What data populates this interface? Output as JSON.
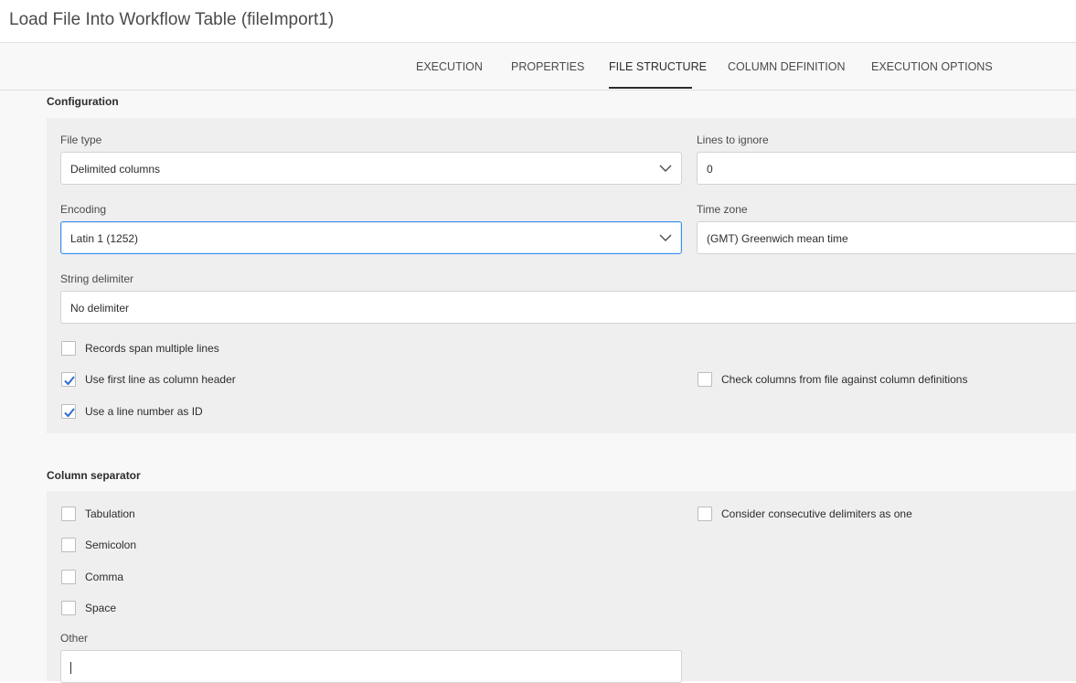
{
  "window": {
    "title": "Load File Into Workflow Table (fileImport1)"
  },
  "tabs": [
    {
      "label": "EXECUTION",
      "active": false
    },
    {
      "label": "PROPERTIES",
      "active": false
    },
    {
      "label": "FILE STRUCTURE",
      "active": true
    },
    {
      "label": "COLUMN DEFINITION",
      "active": false
    },
    {
      "label": "EXECUTION OPTIONS",
      "active": false
    }
  ],
  "configuration": {
    "title": "Configuration",
    "file_type": {
      "label": "File type",
      "value": "Delimited columns"
    },
    "lines_to_ignore": {
      "label": "Lines to ignore",
      "value": "0"
    },
    "encoding": {
      "label": "Encoding",
      "value": "Latin 1 (1252)"
    },
    "time_zone": {
      "label": "Time zone",
      "value": "(GMT) Greenwich mean time"
    },
    "string_delimiter": {
      "label": "String delimiter",
      "value": "No delimiter"
    },
    "checkboxes": {
      "records_span": {
        "label": "Records span multiple lines",
        "checked": false
      },
      "first_line_header": {
        "label": "Use first line as column header",
        "checked": true
      },
      "line_number_id": {
        "label": "Use a line number as ID",
        "checked": true
      },
      "check_columns": {
        "label": "Check columns from file against column definitions",
        "checked": false
      }
    }
  },
  "column_separator": {
    "title": "Column separator",
    "checkboxes": {
      "tabulation": {
        "label": "Tabulation",
        "checked": false
      },
      "semicolon": {
        "label": "Semicolon",
        "checked": false
      },
      "comma": {
        "label": "Comma",
        "checked": false
      },
      "space": {
        "label": "Space",
        "checked": false
      },
      "consecutive": {
        "label": "Consider consecutive delimiters as one",
        "checked": false
      }
    },
    "other": {
      "label": "Other",
      "value": ""
    }
  },
  "colors": {
    "focus_border": "#378ef0",
    "check_color": "#2d6fd1",
    "panel_bg": "#efefef"
  }
}
